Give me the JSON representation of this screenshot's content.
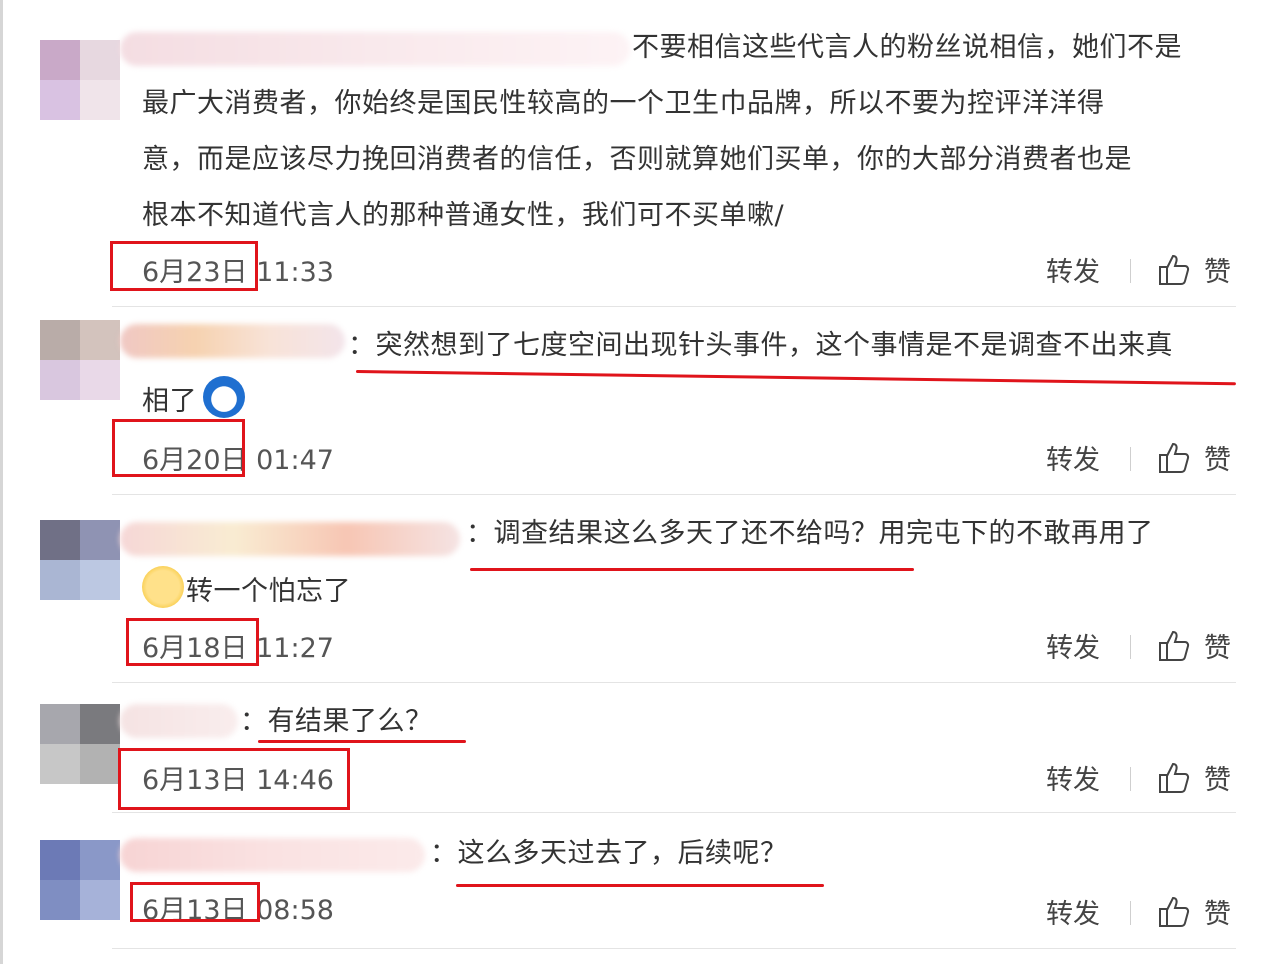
{
  "comments": [
    {
      "text_lines": [
        "不要相信这些代言人的粉丝说相信，她们不是",
        "最广大消费者，你始终是国民性较高的一个卫生巾品牌，所以不要为控评洋洋得",
        "意，而是应该尽力挽回消费者的信任，否则就算她们买单，你的大部分消费者也是",
        "根本不知道代言人的那种普通女性，我们可不买单嗽/"
      ],
      "time": "6月23日 11:33",
      "repost": "转发",
      "like": "赞"
    },
    {
      "text_lines": [
        "：突然想到了七度空间出现针头事件，这个事情是不是调查不出来真",
        "相了"
      ],
      "time": "6月20日 01:47",
      "repost": "转发",
      "like": "赞"
    },
    {
      "text_lines": [
        "：调查结果这么多天了还不给吗？用完屯下的不敢再用了",
        "转一个怕忘了"
      ],
      "time": "6月18日 11:27",
      "repost": "转发",
      "like": "赞"
    },
    {
      "text_lines": [
        "：有结果了么？"
      ],
      "time": "6月13日 14:46",
      "repost": "转发",
      "like": "赞"
    },
    {
      "text_lines": [
        "：这么多天过去了，后续呢？"
      ],
      "time": "6月13日 08:58",
      "repost": "转发",
      "like": "赞"
    }
  ],
  "colors": {
    "annotation_red": "#e0141b",
    "text": "#333333",
    "divider": "#e4e4e4"
  },
  "icons": [
    "thumbs-up-icon",
    "emoji-icon"
  ]
}
